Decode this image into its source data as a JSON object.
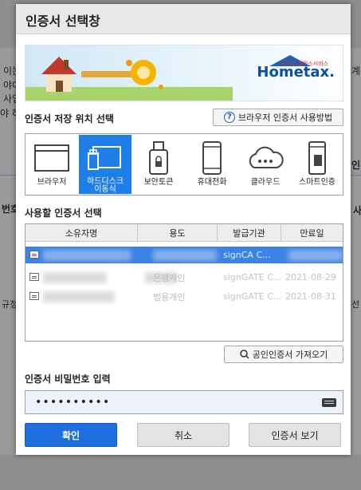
{
  "background": {
    "fragments": [
      "이는",
      "야여",
      "사업",
      "야 하",
      "번호",
      "규정",
      "인-",
      "계산",
      "선 액",
      "사"
    ]
  },
  "dialog": {
    "title": "인증서 선택창",
    "banner": {
      "brand": "Hometax.",
      "brand_sub": "국세청 홈택스서비스"
    },
    "storage": {
      "label": "인증서 저장 위치 선택",
      "help_button": "브라우저 인증서 사용방법",
      "items": [
        {
          "label": "브라우저",
          "icon": "browser-window-icon",
          "selected": false
        },
        {
          "label": "하드디스크\n이동식",
          "icon": "usb-drive-icon",
          "selected": true
        },
        {
          "label": "보안토큰",
          "icon": "security-token-icon",
          "selected": false
        },
        {
          "label": "휴대전화",
          "icon": "mobile-phone-icon",
          "selected": false
        },
        {
          "label": "클라우드",
          "icon": "cloud-icon",
          "selected": false
        },
        {
          "label": "스마트인증",
          "icon": "smart-auth-icon",
          "selected": false
        }
      ]
    },
    "cert_list": {
      "label": "사용할 인증서 선택",
      "columns": [
        "소유자명",
        "용도",
        "발급기관",
        "만료일"
      ],
      "rows": [
        {
          "owner": "",
          "usage": "",
          "issuer": "signCA C...",
          "expiry": "",
          "selected": true
        },
        {
          "owner": "",
          "usage": "은행개인",
          "issuer": "signGATE C...",
          "expiry": "2021-08-29",
          "selected": false
        },
        {
          "owner": "",
          "usage": "범용개인",
          "issuer": "signGATE C...",
          "expiry": "2021-08-31",
          "selected": false
        }
      ]
    },
    "import_button": "공인인증서 가져오기",
    "password": {
      "label": "인증서 비밀번호 입력",
      "value": "••••••••••"
    },
    "buttons": {
      "ok": "확인",
      "cancel": "취소",
      "view": "인증서 보기"
    },
    "colors": {
      "accent": "#1e6fe0",
      "selected_row": "#3b83e6"
    }
  }
}
